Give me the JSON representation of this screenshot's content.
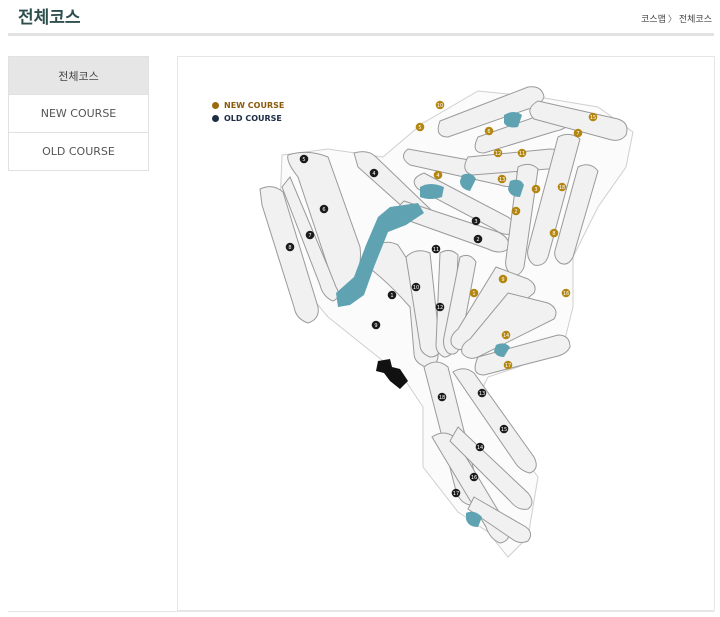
{
  "header": {
    "title": "전체코스",
    "breadcrumb": [
      "코스맵",
      "전체코스"
    ],
    "breadcrumb_separator": "〉"
  },
  "sidebar": {
    "items": [
      {
        "label": "전체코스",
        "active": true
      },
      {
        "label": "NEW COURSE",
        "active": false
      },
      {
        "label": "OLD COURSE",
        "active": false
      }
    ]
  },
  "map": {
    "legend": [
      {
        "label": "NEW COURSE",
        "color": "#9a6a10"
      },
      {
        "label": "OLD COURSE",
        "color": "#1d2d45"
      }
    ],
    "colors": {
      "fairway": "#f2f2f2",
      "outline": "#9a9a9a",
      "water": "#5fa3b2",
      "new_marker": "#b4860f",
      "old_marker": "#1b1b1b"
    },
    "new_holes": [
      "1",
      "2",
      "3",
      "4",
      "5",
      "6",
      "7",
      "8",
      "9",
      "10",
      "11",
      "12",
      "13",
      "14",
      "15",
      "16",
      "17",
      "18"
    ],
    "old_holes": [
      "1",
      "2",
      "3",
      "4",
      "5",
      "6",
      "7",
      "8",
      "9",
      "10",
      "11",
      "12",
      "13",
      "14",
      "15",
      "16",
      "17",
      "18"
    ],
    "clubhouse_icon": "clubhouse-icon"
  }
}
